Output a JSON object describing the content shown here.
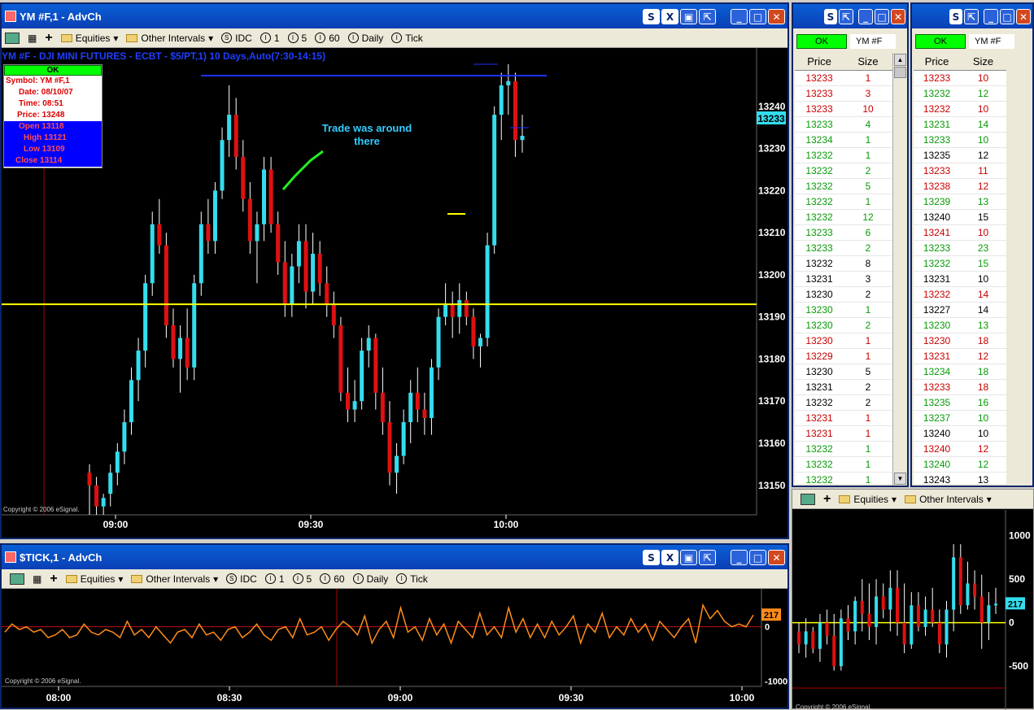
{
  "main": {
    "title": "YM #F,1 - AdvCh",
    "header": "YM #F - DJI MINI FUTURES - ECBT - $5/PT,1) 10 Days,Auto(7:30-14:15)",
    "annotation": [
      "Trade was around",
      "there"
    ],
    "price_tag": "13233",
    "watermark": "Copyright © 2006 eSignal.",
    "info_box": {
      "status": "OK",
      "lines": [
        "Symbol: YM #F,1",
        "Date: 08/10/07",
        "Time: 08:51",
        "Price: 13248"
      ],
      "ohlc": [
        "Open 13118",
        "High 13121",
        "Low 13109",
        "Close 13114"
      ]
    }
  },
  "toolbar": {
    "equities": "Equities",
    "other_intervals": "Other Intervals",
    "idc": "IDC",
    "i1": "1",
    "i5": "5",
    "i60": "60",
    "daily": "Daily",
    "tick": "Tick"
  },
  "stick": {
    "title": "$TICK,1 - AdvCh",
    "value_tag": "217",
    "watermark": "Copyright © 2006 eSignal."
  },
  "tns1": {
    "status": "OK",
    "symbol": "YM #F",
    "col_price": "Price",
    "col_size": "Size",
    "rows": [
      [
        "13233",
        "1",
        "red"
      ],
      [
        "13233",
        "3",
        "red"
      ],
      [
        "13233",
        "10",
        "red"
      ],
      [
        "13233",
        "4",
        "green"
      ],
      [
        "13234",
        "1",
        "green"
      ],
      [
        "13232",
        "1",
        "green"
      ],
      [
        "13232",
        "2",
        "green"
      ],
      [
        "13232",
        "5",
        "green"
      ],
      [
        "13232",
        "1",
        "green"
      ],
      [
        "13232",
        "12",
        "green"
      ],
      [
        "13233",
        "6",
        "green"
      ],
      [
        "13233",
        "2",
        "green"
      ],
      [
        "13232",
        "8",
        "blk"
      ],
      [
        "13231",
        "3",
        "blk"
      ],
      [
        "13230",
        "2",
        "blk"
      ],
      [
        "13230",
        "1",
        "green"
      ],
      [
        "13230",
        "2",
        "green"
      ],
      [
        "13230",
        "1",
        "red"
      ],
      [
        "13229",
        "1",
        "red"
      ],
      [
        "13230",
        "5",
        "blk"
      ],
      [
        "13231",
        "2",
        "blk"
      ],
      [
        "13232",
        "2",
        "blk"
      ],
      [
        "13231",
        "1",
        "red"
      ],
      [
        "13231",
        "1",
        "red"
      ],
      [
        "13232",
        "1",
        "green"
      ],
      [
        "13232",
        "1",
        "green"
      ],
      [
        "13232",
        "1",
        "green"
      ]
    ]
  },
  "tns2": {
    "status": "OK",
    "symbol": "YM #F",
    "col_price": "Price",
    "col_size": "Size",
    "rows": [
      [
        "13233",
        "10",
        "red"
      ],
      [
        "13232",
        "12",
        "green"
      ],
      [
        "13232",
        "10",
        "red"
      ],
      [
        "13231",
        "14",
        "green"
      ],
      [
        "13233",
        "10",
        "green"
      ],
      [
        "13235",
        "12",
        "blk"
      ],
      [
        "13233",
        "11",
        "red"
      ],
      [
        "13238",
        "12",
        "red"
      ],
      [
        "13239",
        "13",
        "green"
      ],
      [
        "13240",
        "15",
        "blk"
      ],
      [
        "13241",
        "10",
        "red"
      ],
      [
        "13233",
        "23",
        "green"
      ],
      [
        "13232",
        "15",
        "green"
      ],
      [
        "13231",
        "10",
        "blk"
      ],
      [
        "13232",
        "14",
        "red"
      ],
      [
        "13227",
        "14",
        "blk"
      ],
      [
        "13230",
        "13",
        "green"
      ],
      [
        "13230",
        "18",
        "red"
      ],
      [
        "13231",
        "12",
        "red"
      ],
      [
        "13234",
        "18",
        "green"
      ],
      [
        "13233",
        "18",
        "red"
      ],
      [
        "13235",
        "16",
        "green"
      ],
      [
        "13237",
        "10",
        "green"
      ],
      [
        "13240",
        "10",
        "blk"
      ],
      [
        "13240",
        "12",
        "red"
      ],
      [
        "13240",
        "12",
        "green"
      ],
      [
        "13243",
        "13",
        "blk"
      ]
    ]
  },
  "mini": {
    "value_tag": "217",
    "watermark": "Copyright © 2006 eSignal."
  },
  "chart_data": [
    {
      "type": "candlestick",
      "title": "YM #F - DJI MINI FUTURES - ECBT - $5/PT,1) 10 Days,Auto(7:30-14:15)",
      "x_ticks": [
        "09:00",
        "09:30",
        "10:00"
      ],
      "y_ticks": [
        13150,
        13160,
        13170,
        13180,
        13190,
        13200,
        13210,
        13220,
        13230,
        13240
      ],
      "ylim": [
        13143,
        13250
      ],
      "horizontal_line": 13193,
      "ohlc": [
        [
          13153,
          13155,
          13143,
          13150
        ],
        [
          13150,
          13152,
          13143,
          13145
        ],
        [
          13145,
          13148,
          13143,
          13147
        ],
        [
          13148,
          13155,
          13145,
          13153
        ],
        [
          13153,
          13160,
          13150,
          13158
        ],
        [
          13158,
          13168,
          13155,
          13165
        ],
        [
          13165,
          13178,
          13162,
          13175
        ],
        [
          13175,
          13185,
          13170,
          13182
        ],
        [
          13182,
          13200,
          13178,
          13198
        ],
        [
          13198,
          13215,
          13195,
          13212
        ],
        [
          13212,
          13218,
          13205,
          13207
        ],
        [
          13207,
          13210,
          13185,
          13188
        ],
        [
          13188,
          13192,
          13178,
          13180
        ],
        [
          13180,
          13188,
          13172,
          13185
        ],
        [
          13185,
          13192,
          13175,
          13178
        ],
        [
          13178,
          13200,
          13175,
          13198
        ],
        [
          13198,
          13215,
          13195,
          13212
        ],
        [
          13212,
          13218,
          13205,
          13208
        ],
        [
          13208,
          13222,
          13205,
          13220
        ],
        [
          13220,
          13235,
          13218,
          13232
        ],
        [
          13232,
          13245,
          13228,
          13238
        ],
        [
          13238,
          13242,
          13225,
          13228
        ],
        [
          13228,
          13232,
          13215,
          13218
        ],
        [
          13218,
          13222,
          13205,
          13208
        ],
        [
          13208,
          13215,
          13198,
          13212
        ],
        [
          13212,
          13228,
          13208,
          13225
        ],
        [
          13225,
          13228,
          13210,
          13212
        ],
        [
          13212,
          13215,
          13200,
          13203
        ],
        [
          13203,
          13208,
          13190,
          13193
        ],
        [
          13193,
          13205,
          13190,
          13202
        ],
        [
          13202,
          13212,
          13198,
          13208
        ],
        [
          13208,
          13212,
          13192,
          13196
        ],
        [
          13196,
          13210,
          13193,
          13205
        ],
        [
          13205,
          13208,
          13195,
          13198
        ],
        [
          13198,
          13202,
          13190,
          13193
        ],
        [
          13193,
          13196,
          13185,
          13188
        ],
        [
          13188,
          13190,
          13170,
          13172
        ],
        [
          13172,
          13178,
          13165,
          13168
        ],
        [
          13168,
          13175,
          13165,
          13170
        ],
        [
          13170,
          13185,
          13168,
          13182
        ],
        [
          13182,
          13188,
          13178,
          13185
        ],
        [
          13185,
          13186,
          13168,
          13172
        ],
        [
          13172,
          13178,
          13162,
          13165
        ],
        [
          13165,
          13170,
          13150,
          13153
        ],
        [
          13153,
          13160,
          13148,
          13157
        ],
        [
          13157,
          13168,
          13155,
          13165
        ],
        [
          13165,
          13175,
          13160,
          13172
        ],
        [
          13172,
          13178,
          13165,
          13168
        ],
        [
          13168,
          13172,
          13162,
          13166
        ],
        [
          13166,
          13180,
          13162,
          13178
        ],
        [
          13178,
          13192,
          13175,
          13190
        ],
        [
          13190,
          13198,
          13188,
          13193
        ],
        [
          13193,
          13196,
          13185,
          13190
        ],
        [
          13190,
          13198,
          13186,
          13194
        ],
        [
          13194,
          13196,
          13188,
          13190
        ],
        [
          13190,
          13192,
          13180,
          13183
        ],
        [
          13183,
          13186,
          13178,
          13185
        ],
        [
          13185,
          13210,
          13183,
          13207
        ],
        [
          13207,
          13240,
          13205,
          13238
        ],
        [
          13238,
          13248,
          13232,
          13245
        ],
        [
          13245,
          13250,
          13238,
          13246
        ],
        [
          13246,
          13248,
          13228,
          13232
        ],
        [
          13232,
          13238,
          13229,
          13233
        ]
      ]
    },
    {
      "type": "line",
      "title": "$TICK,1",
      "x_ticks": [
        "08:00",
        "08:30",
        "09:00",
        "09:30",
        "10:00"
      ],
      "y_ticks": [
        0,
        -1000
      ],
      "ylim": [
        -1100,
        700
      ],
      "values": [
        -100,
        50,
        -50,
        0,
        -100,
        -50,
        -200,
        -150,
        -50,
        -200,
        -150,
        50,
        -100,
        -150,
        -50,
        -100,
        -200,
        100,
        -150,
        -50,
        -200,
        0,
        -150,
        -300,
        -100,
        -50,
        -200,
        50,
        -150,
        -100,
        -250,
        -50,
        0,
        -200,
        -100,
        50,
        -150,
        -250,
        -50,
        0,
        -200,
        150,
        -150,
        -100,
        0,
        -250,
        -50,
        100,
        0,
        -150,
        200,
        -300,
        -50,
        100,
        -200,
        350,
        -100,
        0,
        -250,
        150,
        -150,
        50,
        -300,
        100,
        -50,
        -200,
        250,
        -150,
        0,
        -200,
        350,
        -100,
        150,
        -200,
        50,
        -200,
        100,
        -150,
        0,
        200,
        -300,
        50,
        -100,
        250,
        -200,
        0,
        -150,
        150,
        -100,
        50,
        -250,
        100,
        -50,
        -200,
        0,
        150,
        -300,
        400,
        150,
        300,
        100,
        0,
        50,
        0,
        217
      ]
    },
    {
      "type": "candlestick",
      "title": "",
      "y_ticks": [
        1000,
        500,
        0,
        -500
      ],
      "ylim": [
        -750,
        1200
      ],
      "ohlc": [
        [
          -100,
          0,
          -350,
          -250
        ],
        [
          -250,
          50,
          -400,
          -100
        ],
        [
          -100,
          -50,
          -350,
          -300
        ],
        [
          -300,
          100,
          -450,
          0
        ],
        [
          0,
          150,
          -250,
          -150
        ],
        [
          -150,
          100,
          -550,
          -500
        ],
        [
          -500,
          150,
          -550,
          50
        ],
        [
          50,
          200,
          -200,
          -100
        ],
        [
          -100,
          300,
          -250,
          250
        ],
        [
          250,
          500,
          -100,
          100
        ],
        [
          100,
          450,
          -200,
          -50
        ],
        [
          -50,
          500,
          -250,
          300
        ],
        [
          300,
          450,
          50,
          150
        ],
        [
          150,
          600,
          -100,
          400
        ],
        [
          400,
          600,
          -150,
          0
        ],
        [
          0,
          450,
          -350,
          -250
        ],
        [
          -250,
          350,
          -300,
          200
        ],
        [
          200,
          350,
          -100,
          -50
        ],
        [
          -50,
          300,
          -150,
          150
        ],
        [
          150,
          400,
          -50,
          0
        ],
        [
          0,
          150,
          -350,
          -250
        ],
        [
          -250,
          250,
          -400,
          150
        ],
        [
          150,
          900,
          -100,
          750
        ],
        [
          750,
          900,
          100,
          200
        ],
        [
          200,
          700,
          150,
          450
        ],
        [
          450,
          600,
          150,
          300
        ],
        [
          300,
          550,
          -300,
          0
        ],
        [
          0,
          350,
          -200,
          200
        ],
        [
          200,
          400,
          100,
          217
        ]
      ]
    }
  ]
}
